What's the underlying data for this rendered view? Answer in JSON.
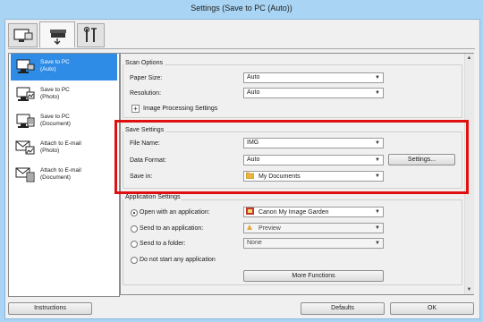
{
  "window": {
    "title": "Settings (Save to PC (Auto))"
  },
  "tabs": [
    {
      "name": "scan-from-computer",
      "icon": "computer-scan-icon"
    },
    {
      "name": "scan-from-operation-panel",
      "icon": "scanner-icon"
    },
    {
      "name": "general-settings",
      "icon": "tools-icon"
    }
  ],
  "sidebar": {
    "items": [
      {
        "line1": "Save to PC",
        "line2": "(Auto)",
        "selected": true,
        "icon": "pc-auto-icon"
      },
      {
        "line1": "Save to PC",
        "line2": "(Photo)",
        "selected": false,
        "icon": "pc-photo-icon"
      },
      {
        "line1": "Save to PC",
        "line2": "(Document)",
        "selected": false,
        "icon": "pc-document-icon"
      },
      {
        "line1": "Attach to E-mail",
        "line2": "(Photo)",
        "selected": false,
        "icon": "email-photo-icon"
      },
      {
        "line1": "Attach to E-mail",
        "line2": "(Document)",
        "selected": false,
        "icon": "email-document-icon"
      }
    ]
  },
  "scan_options": {
    "title": "Scan Options",
    "paper_size_label": "Paper Size:",
    "paper_size_value": "Auto",
    "resolution_label": "Resolution:",
    "resolution_value": "Auto",
    "image_processing_label": "Image Processing Settings"
  },
  "save_settings": {
    "title": "Save Settings",
    "file_name_label": "File Name:",
    "file_name_value": "IMG",
    "data_format_label": "Data Format:",
    "data_format_value": "Auto",
    "settings_button": "Settings...",
    "save_in_label": "Save in:",
    "save_in_value": "My Documents"
  },
  "app_settings": {
    "title": "Application Settings",
    "open_label": "Open with an application:",
    "open_value": "Canon My Image Garden",
    "send_app_label": "Send to an application:",
    "send_app_value": "Preview",
    "send_folder_label": "Send to a folder:",
    "send_folder_value": "None",
    "no_start_label": "Do not start any application",
    "more_functions_button": "More Functions"
  },
  "footer": {
    "instructions": "Instructions",
    "defaults": "Defaults",
    "ok": "OK"
  }
}
